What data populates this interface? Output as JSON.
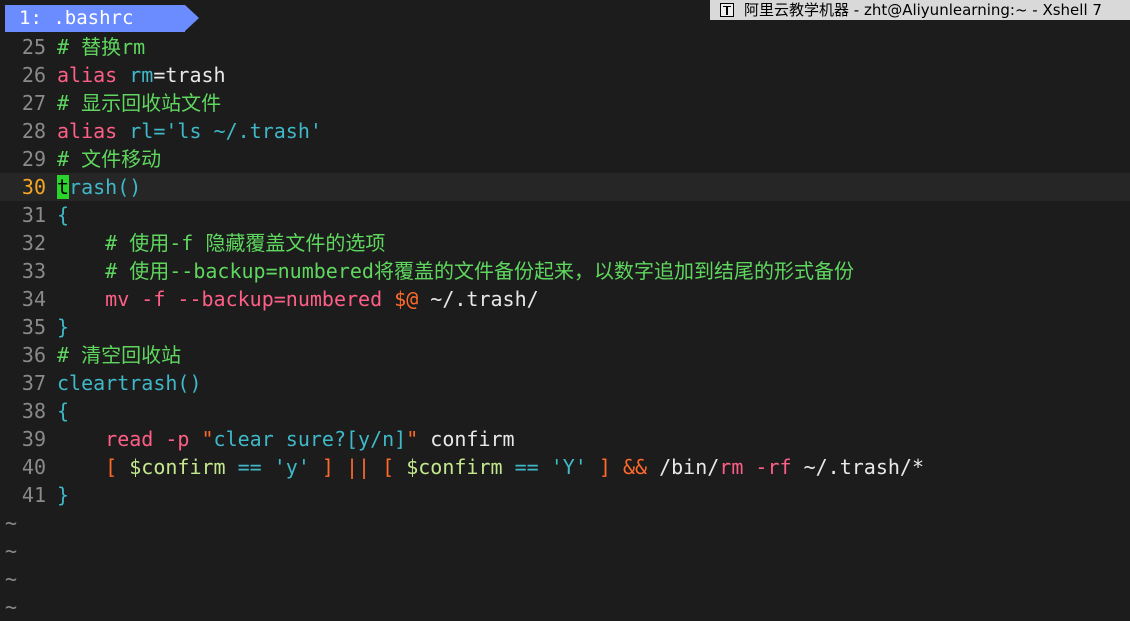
{
  "tab": {
    "label": "1: .bashrc"
  },
  "window": {
    "title": "阿里云教学机器 - zht@Aliyunlearning:~ - Xshell 7"
  },
  "editor": {
    "current_line": 30,
    "lines": [
      {
        "n": "25",
        "tokens": [
          {
            "t": "# 替换rm",
            "c": "comment"
          }
        ]
      },
      {
        "n": "26",
        "tokens": [
          {
            "t": "alias ",
            "c": "keyword"
          },
          {
            "t": "rm",
            "c": "func"
          },
          {
            "t": "=trash",
            "c": "plain"
          }
        ]
      },
      {
        "n": "27",
        "tokens": [
          {
            "t": "# 显示回收站文件",
            "c": "comment"
          }
        ]
      },
      {
        "n": "28",
        "tokens": [
          {
            "t": "alias ",
            "c": "keyword"
          },
          {
            "t": "rl=",
            "c": "func"
          },
          {
            "t": "'ls ~/.trash'",
            "c": "string"
          }
        ]
      },
      {
        "n": "29",
        "tokens": [
          {
            "t": "# 文件移动",
            "c": "comment"
          }
        ]
      },
      {
        "n": "30",
        "tokens": [
          {
            "t": "t",
            "c": "cursor"
          },
          {
            "t": "rash()",
            "c": "func"
          }
        ]
      },
      {
        "n": "31",
        "tokens": [
          {
            "t": "{",
            "c": "brace"
          }
        ]
      },
      {
        "n": "32",
        "tokens": [
          {
            "t": "    # 使用-f 隐藏覆盖文件的选项",
            "c": "comment"
          }
        ]
      },
      {
        "n": "33",
        "tokens": [
          {
            "t": "    # 使用--backup=numbered将覆盖的文件备份起来，以数字追加到结尾的形式备份",
            "c": "comment"
          }
        ]
      },
      {
        "n": "34",
        "tokens": [
          {
            "t": "    mv -f --backup=numbered ",
            "c": "builtin"
          },
          {
            "t": "$@",
            "c": "op"
          },
          {
            "t": " ~/.trash/",
            "c": "plain"
          }
        ]
      },
      {
        "n": "35",
        "tokens": [
          {
            "t": "}",
            "c": "brace"
          }
        ]
      },
      {
        "n": "36",
        "tokens": [
          {
            "t": "# 清空回收站",
            "c": "comment"
          }
        ]
      },
      {
        "n": "37",
        "tokens": [
          {
            "t": "cleartrash()",
            "c": "func"
          }
        ]
      },
      {
        "n": "38",
        "tokens": [
          {
            "t": "{",
            "c": "brace"
          }
        ]
      },
      {
        "n": "39",
        "tokens": [
          {
            "t": "    read -p ",
            "c": "builtin"
          },
          {
            "t": "\"",
            "c": "op"
          },
          {
            "t": "clear sure?[y/n]",
            "c": "string"
          },
          {
            "t": "\"",
            "c": "op"
          },
          {
            "t": " confirm",
            "c": "plain"
          }
        ]
      },
      {
        "n": "40",
        "tokens": [
          {
            "t": "    [ ",
            "c": "op"
          },
          {
            "t": "$confirm",
            "c": "var"
          },
          {
            "t": " == ",
            "c": "string"
          },
          {
            "t": "'y'",
            "c": "string"
          },
          {
            "t": " ] || [ ",
            "c": "op"
          },
          {
            "t": "$confirm",
            "c": "var"
          },
          {
            "t": " == ",
            "c": "string"
          },
          {
            "t": "'Y'",
            "c": "string"
          },
          {
            "t": " ] && ",
            "c": "op"
          },
          {
            "t": "/bin/",
            "c": "plain"
          },
          {
            "t": "rm",
            "c": "builtin"
          },
          {
            "t": " -rf",
            "c": "flag"
          },
          {
            "t": " ~/.trash/*",
            "c": "plain"
          }
        ]
      },
      {
        "n": "41",
        "tokens": [
          {
            "t": "}",
            "c": "brace"
          }
        ]
      }
    ],
    "tildes": [
      "~",
      "~",
      "~",
      "~"
    ]
  }
}
